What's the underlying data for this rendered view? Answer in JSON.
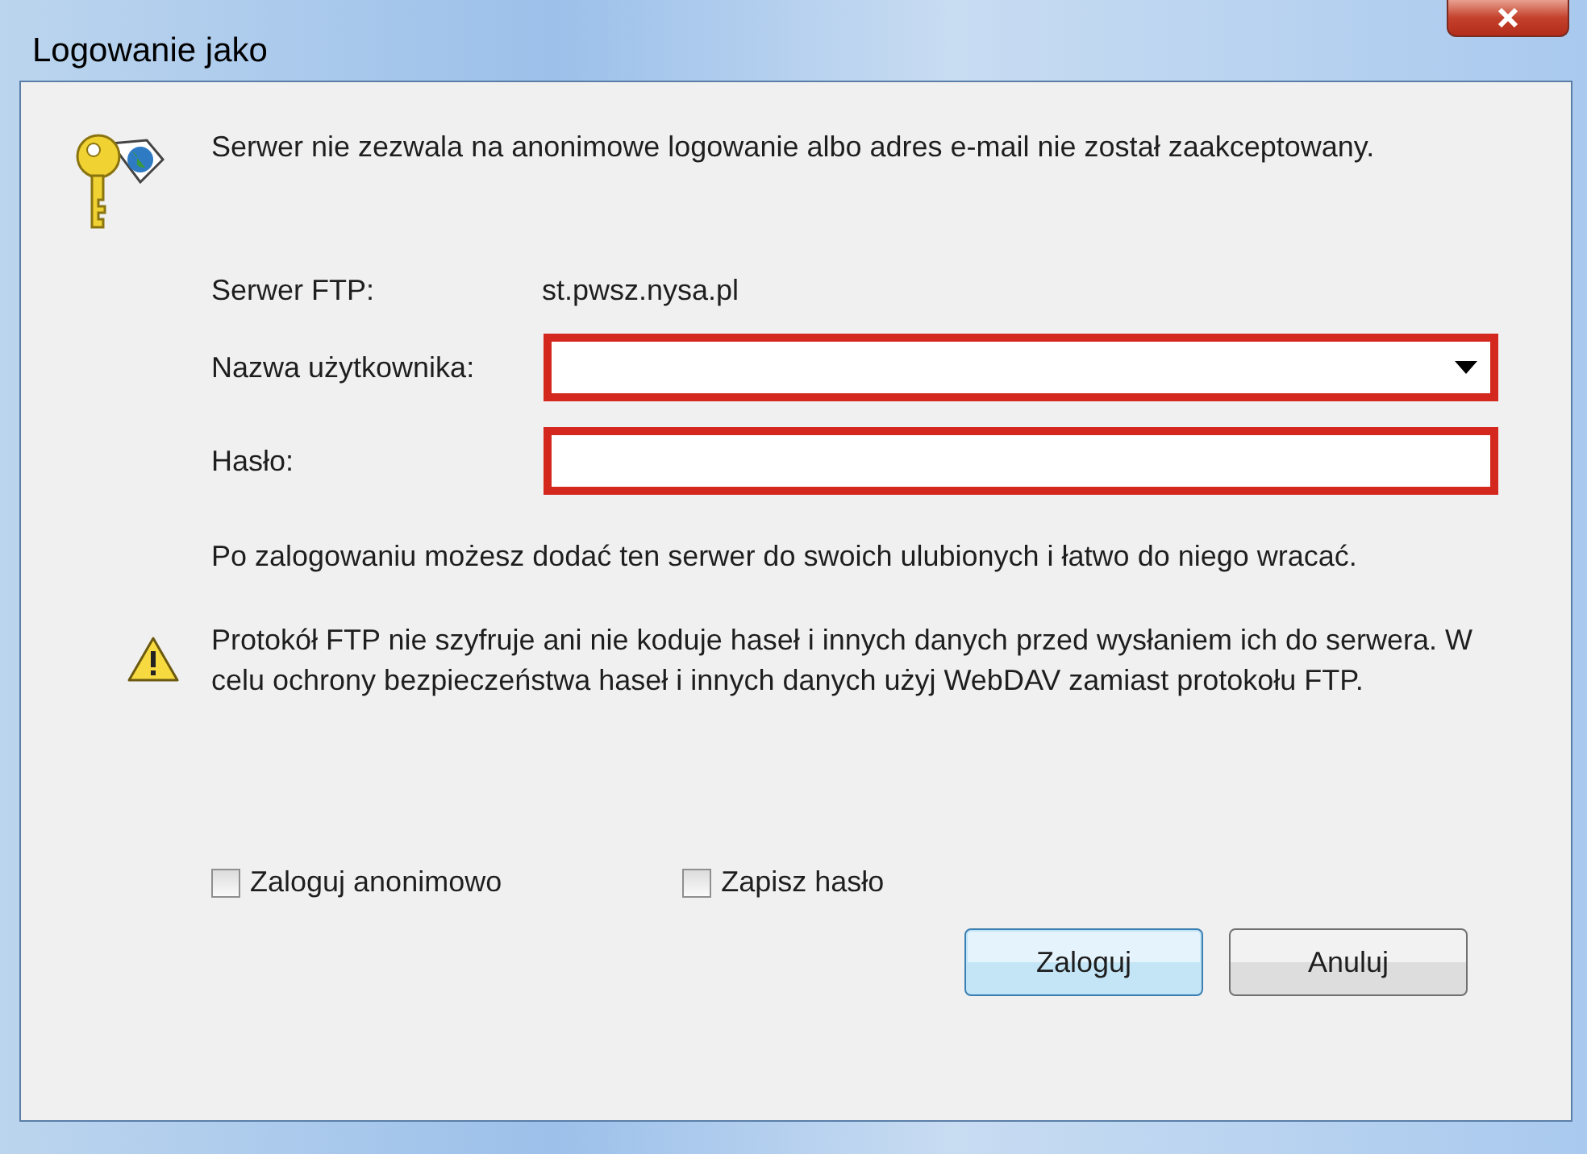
{
  "window": {
    "title": "Logowanie jako"
  },
  "message": "Serwer nie zezwala na anonimowe logowanie albo adres e-mail nie został zaakceptowany.",
  "server": {
    "label": "Serwer FTP:",
    "value": "st.pwsz.nysa.pl"
  },
  "fields": [
    {
      "kind": "dropdown",
      "label": "Nazwa użytkownika:",
      "highlighted": true
    },
    {
      "kind": "password",
      "label": "Hasło:",
      "highlighted": true
    }
  ],
  "info": "Po zalogowaniu możesz dodać ten serwer do swoich ulubionych i łatwo do niego wracać.",
  "warning": "Protokół FTP nie szyfruje ani nie koduje haseł i innych danych przed wysłaniem ich do serwera. W celu ochrony bezpieczeństwa haseł i innych danych użyj WebDAV zamiast protokołu FTP.",
  "checkboxes": [
    {
      "label": "Zaloguj anonimowo",
      "checked": false
    },
    {
      "label": "Zapisz hasło",
      "checked": false
    }
  ],
  "buttons": [
    {
      "label": "Zaloguj",
      "default": true
    },
    {
      "label": "Anuluj",
      "default": false
    }
  ]
}
